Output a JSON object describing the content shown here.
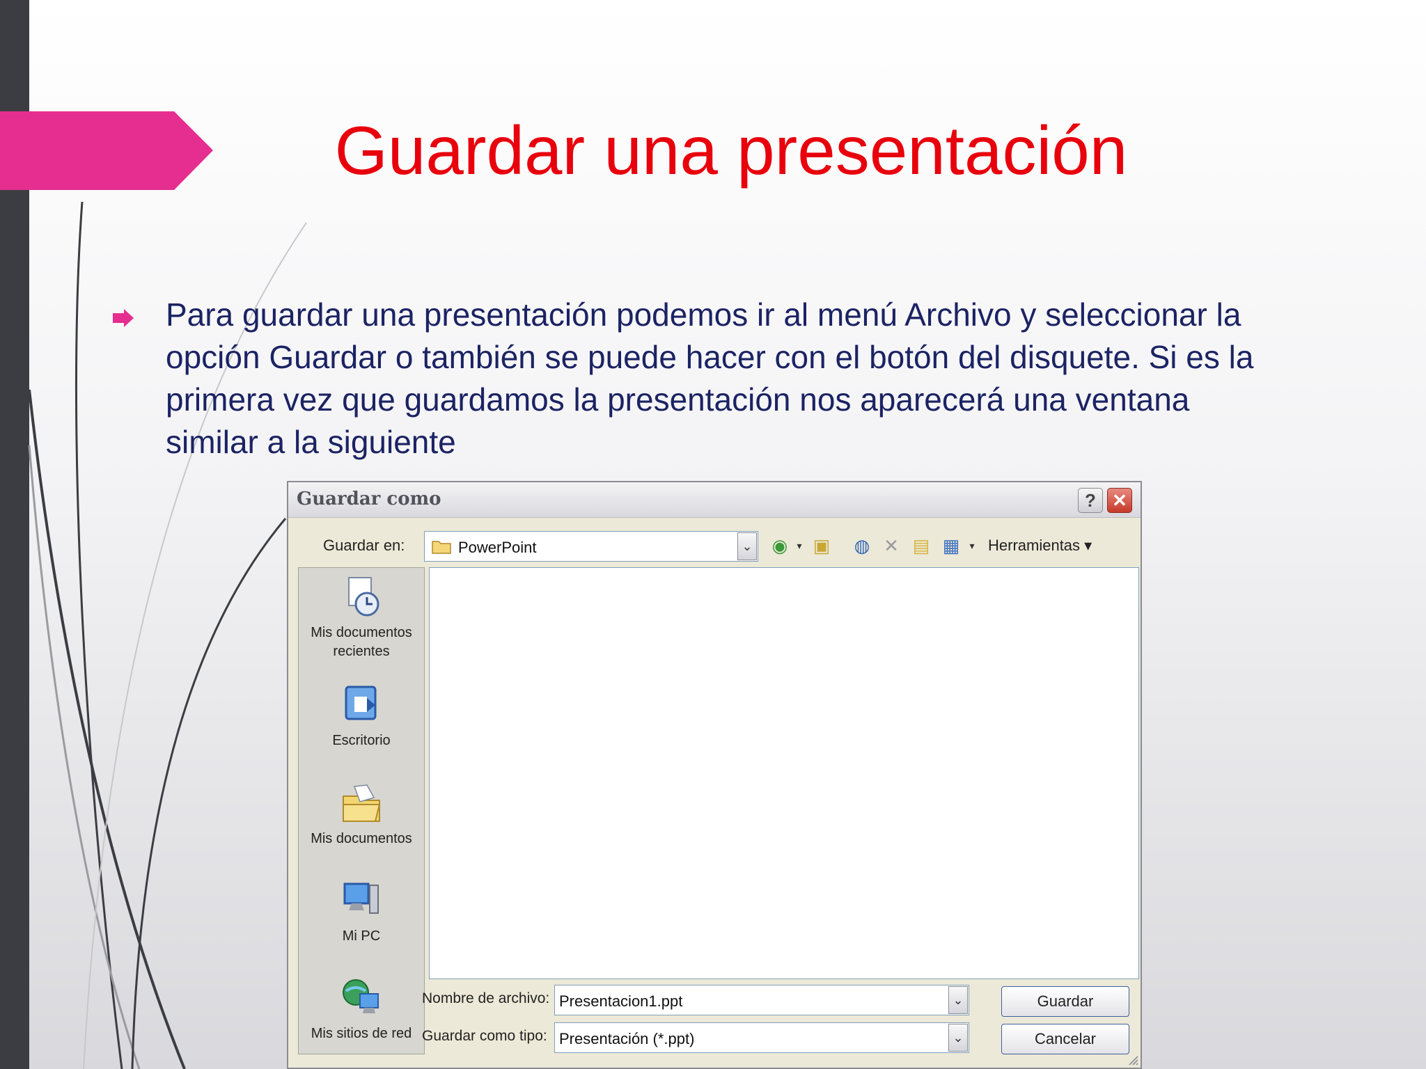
{
  "slide": {
    "title": "Guardar una presentación",
    "body": "Para guardar una presentación podemos ir al menú Archivo y seleccionar la opción Guardar o también se puede hacer con el botón del disquete. Si es la primera vez que guardamos la presentación nos aparecerá una ventana similar a la siguiente"
  },
  "colors": {
    "title": "#e8000c",
    "body_text": "#1b2363",
    "accent_arrow": "#e52e8f",
    "side_bar": "#3c3d42"
  },
  "dialog": {
    "title": "Guardar como",
    "help_button": "?",
    "close_button": "✕",
    "save_in_label": "Guardar en:",
    "current_folder": "PowerPoint",
    "tools_label": "Herramientas ▾",
    "places": [
      {
        "label": "Mis documentos recientes",
        "icon": "recent-documents-icon"
      },
      {
        "label": "Escritorio",
        "icon": "desktop-icon"
      },
      {
        "label": "Mis documentos",
        "icon": "my-documents-icon"
      },
      {
        "label": "Mi PC",
        "icon": "my-computer-icon"
      },
      {
        "label": "Mis sitios de red",
        "icon": "network-places-icon"
      }
    ],
    "file_name_label": "Nombre de archivo:",
    "file_name_value": "Presentacion1.ppt",
    "file_type_label": "Guardar como tipo:",
    "file_type_value": "Presentación (*.ppt)",
    "save_button": "Guardar",
    "cancel_button": "Cancelar",
    "toolbar_icons": [
      "back-icon",
      "up-folder-icon",
      "search-web-icon",
      "delete-icon",
      "new-folder-icon",
      "views-icon"
    ]
  }
}
